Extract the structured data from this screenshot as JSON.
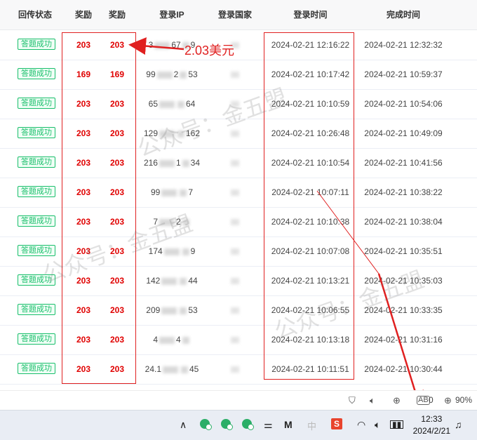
{
  "table": {
    "headers": [
      "回传状态",
      "奖励",
      "奖励",
      "登录IP",
      "登录国家",
      "登录时间",
      "完成时间"
    ],
    "rows": [
      {
        "status": "答题成功",
        "reward1": "203",
        "reward2": "203",
        "ip_start": "3",
        "ip_mid": "67",
        "ip_end": "9",
        "login_time": "2024-02-21 12:16:22",
        "done_time": "2024-02-21 12:32:32"
      },
      {
        "status": "答题成功",
        "reward1": "169",
        "reward2": "169",
        "ip_start": "99",
        "ip_mid": "2",
        "ip_end": "53",
        "login_time": "2024-02-21 10:17:42",
        "done_time": "2024-02-21 10:59:37"
      },
      {
        "status": "答题成功",
        "reward1": "203",
        "reward2": "203",
        "ip_start": "65",
        "ip_mid": "",
        "ip_end": "64",
        "login_time": "2024-02-21 10:10:59",
        "done_time": "2024-02-21 10:54:06"
      },
      {
        "status": "答题成功",
        "reward1": "203",
        "reward2": "203",
        "ip_start": "129",
        "ip_mid": "",
        "ip_end": "162",
        "login_time": "2024-02-21 10:26:48",
        "done_time": "2024-02-21 10:49:09"
      },
      {
        "status": "答题成功",
        "reward1": "203",
        "reward2": "203",
        "ip_start": "216",
        "ip_mid": "1",
        "ip_end": "34",
        "login_time": "2024-02-21 10:10:54",
        "done_time": "2024-02-21 10:41:56"
      },
      {
        "status": "答题成功",
        "reward1": "203",
        "reward2": "203",
        "ip_start": "99",
        "ip_mid": "",
        "ip_end": "7",
        "login_time": "2024-02-21 10:07:11",
        "done_time": "2024-02-21 10:38:22"
      },
      {
        "status": "答题成功",
        "reward1": "203",
        "reward2": "203",
        "ip_start": "7",
        "ip_mid": "2",
        "ip_end": "",
        "login_time": "2024-02-21 10:10:38",
        "done_time": "2024-02-21 10:38:04"
      },
      {
        "status": "答题成功",
        "reward1": "203",
        "reward2": "203",
        "ip_start": "174",
        "ip_mid": "",
        "ip_end": "9",
        "login_time": "2024-02-21 10:07:08",
        "done_time": "2024-02-21 10:35:51"
      },
      {
        "status": "答题成功",
        "reward1": "203",
        "reward2": "203",
        "ip_start": "142",
        "ip_mid": "",
        "ip_end": "44",
        "login_time": "2024-02-21 10:13:21",
        "done_time": "2024-02-21 10:35:03"
      },
      {
        "status": "答题成功",
        "reward1": "203",
        "reward2": "203",
        "ip_start": "209",
        "ip_mid": "",
        "ip_end": "53",
        "login_time": "2024-02-21 10:06:55",
        "done_time": "2024-02-21 10:33:35"
      },
      {
        "status": "答题成功",
        "reward1": "203",
        "reward2": "203",
        "ip_start": "4",
        "ip_mid": "4",
        "ip_end": "",
        "login_time": "2024-02-21 10:13:18",
        "done_time": "2024-02-21 10:31:16"
      },
      {
        "status": "答题成功",
        "reward1": "203",
        "reward2": "203",
        "ip_start": "24.1",
        "ip_mid": "",
        "ip_end": "45",
        "login_time": "2024-02-21 10:11:51",
        "done_time": "2024-02-21 10:30:44"
      }
    ]
  },
  "annotation": {
    "text": "2.03美元",
    "color": "#e02020"
  },
  "watermark": {
    "text": "公众号：金五盟"
  },
  "browser_status": {
    "extension_count": "0",
    "zoom": "90%"
  },
  "taskbar": {
    "clock_time": "12:33",
    "clock_date": "2024/2/21",
    "ime": "中",
    "sogou": "S"
  },
  "colors": {
    "success": "#19be6b",
    "reward": "#e00000",
    "annotation_red": "#e02020"
  }
}
